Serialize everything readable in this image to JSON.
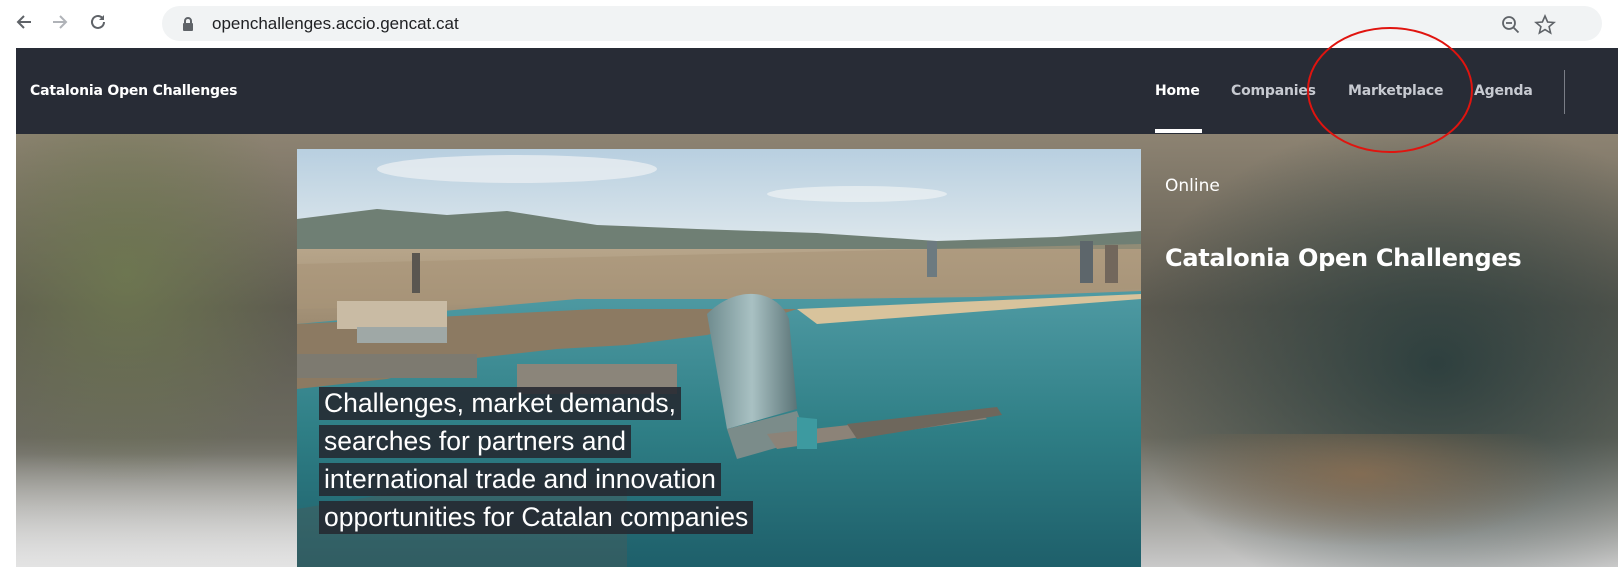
{
  "browser": {
    "url": "openchallenges.accio.gencat.cat"
  },
  "site": {
    "brand": "Catalonia Open Challenges",
    "nav": [
      {
        "label": "Home",
        "active": true
      },
      {
        "label": "Companies",
        "active": false
      },
      {
        "label": "Marketplace",
        "active": false
      },
      {
        "label": "Agenda",
        "active": false
      }
    ]
  },
  "hero": {
    "caption_lines": [
      "Challenges, market demands,",
      "searches for partners and",
      "international trade and innovation",
      "opportunities for Catalan companies"
    ],
    "meta": "Online",
    "title": "Catalonia Open Challenges",
    "image": "aerial-barcelona-waterfront-photo"
  },
  "colors": {
    "header_bg": "#282c36",
    "highlight": "#e0140f",
    "caption_bg": "#242830"
  }
}
